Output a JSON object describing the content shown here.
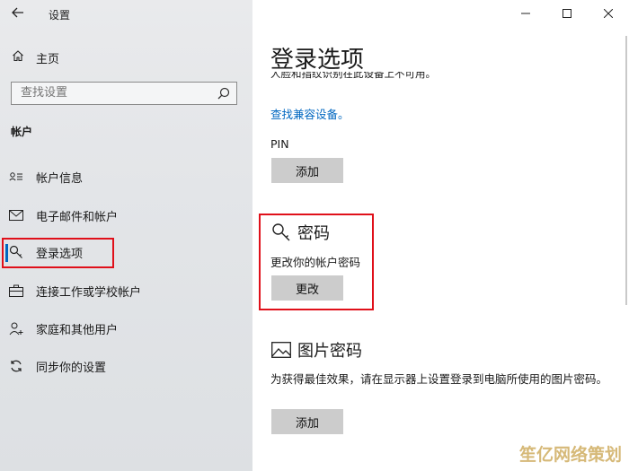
{
  "window": {
    "title": "设置"
  },
  "sidebar": {
    "home_label": "主页",
    "search_placeholder": "查找设置",
    "section_title": "帐户",
    "items": [
      {
        "label": "帐户信息",
        "icon": "person-card-icon"
      },
      {
        "label": "电子邮件和帐户",
        "icon": "mail-icon"
      },
      {
        "label": "登录选项",
        "icon": "key-icon",
        "active": true
      },
      {
        "label": "连接工作或学校帐户",
        "icon": "briefcase-icon"
      },
      {
        "label": "家庭和其他用户",
        "icon": "person-add-icon"
      },
      {
        "label": "同步你的设置",
        "icon": "sync-icon"
      }
    ]
  },
  "main": {
    "title": "登录选项",
    "clipped_text": "人脸和指纹识别在此设备上不可用。",
    "compat_link": "查找兼容设备。",
    "pin": {
      "label": "PIN",
      "button": "添加"
    },
    "password": {
      "heading": "密码",
      "description": "更改你的帐户密码",
      "button": "更改"
    },
    "picture_password": {
      "heading": "图片密码",
      "description": "为获得最佳效果，请在显示器上设置登录到电脑所使用的图片密码。",
      "button": "添加"
    }
  },
  "watermark": "笙亿网络策划",
  "colors": {
    "accent": "#0067c0",
    "highlight_box": "#e0101a",
    "button_bg": "#cccccc"
  }
}
